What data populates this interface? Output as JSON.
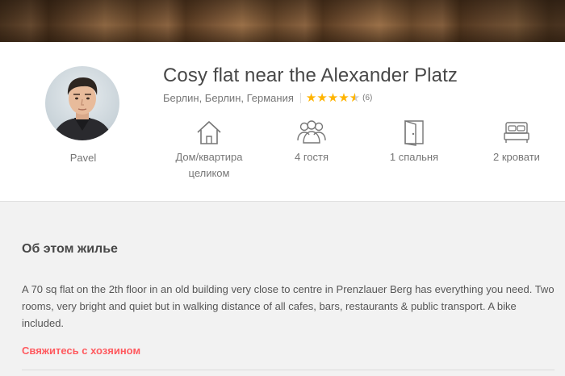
{
  "listing": {
    "title": "Cosy flat near the Alexander Platz",
    "location": "Берлин, Берлин, Германия",
    "rating": 4.5,
    "reviews": "(6)",
    "host_name": "Pavel"
  },
  "features": [
    {
      "icon": "house-icon",
      "label": "Дом/квартира целиком"
    },
    {
      "icon": "guests-icon",
      "label": "4 гостя"
    },
    {
      "icon": "door-icon",
      "label": "1 спальня"
    },
    {
      "icon": "bed-icon",
      "label": "2 кровати"
    }
  ],
  "about": {
    "heading": "Об этом жилье",
    "description": "A 70 sq flat on the 2th floor in an old building very close to centre in Prenzlauer Berg has everything you need. Two rooms, very bright and quiet but in walking distance of all cafes, bars, restaurants & public transport. A bike included.",
    "contact_label": "Свяжитесь с хозяином"
  },
  "colors": {
    "accent": "#ff5a5f",
    "star": "#ffb400",
    "text": "#484848",
    "muted": "#767676"
  }
}
